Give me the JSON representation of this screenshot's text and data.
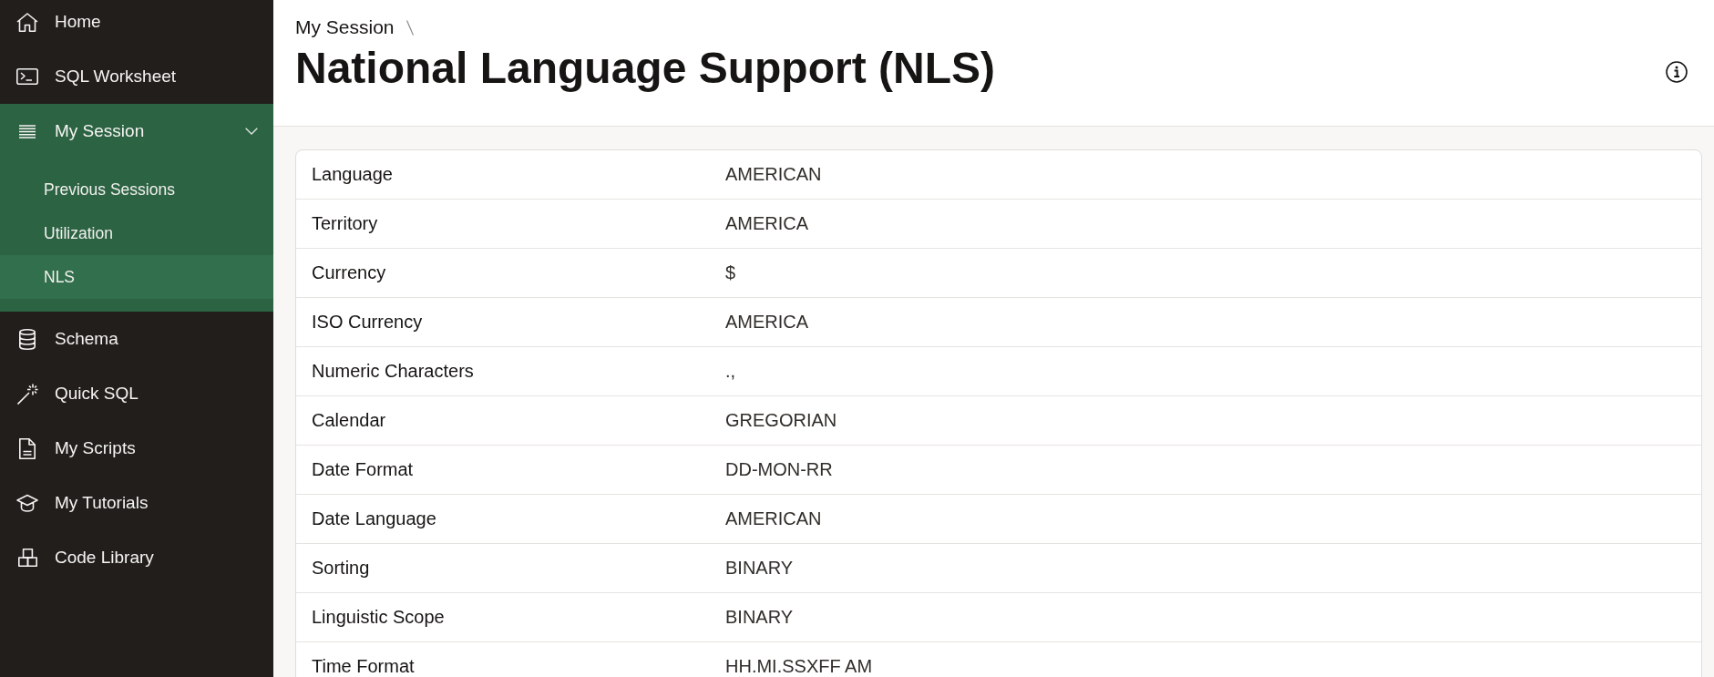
{
  "sidebar": {
    "items": [
      {
        "label": "Home",
        "selected": false
      },
      {
        "label": "SQL Worksheet",
        "selected": false
      },
      {
        "label": "My Session",
        "selected": true,
        "expanded": true,
        "children": [
          {
            "label": "Previous Sessions",
            "selected": false
          },
          {
            "label": "Utilization",
            "selected": false
          },
          {
            "label": "NLS",
            "selected": true
          }
        ]
      },
      {
        "label": "Schema",
        "selected": false
      },
      {
        "label": "Quick SQL",
        "selected": false
      },
      {
        "label": "My Scripts",
        "selected": false
      },
      {
        "label": "My Tutorials",
        "selected": false
      },
      {
        "label": "Code Library",
        "selected": false
      }
    ]
  },
  "header": {
    "breadcrumb": [
      {
        "label": "My Session"
      }
    ],
    "title": "National Language Support (NLS)"
  },
  "table": {
    "rows": [
      {
        "name": "Language",
        "value": "AMERICAN"
      },
      {
        "name": "Territory",
        "value": "AMERICA"
      },
      {
        "name": "Currency",
        "value": "$"
      },
      {
        "name": "ISO Currency",
        "value": "AMERICA"
      },
      {
        "name": "Numeric Characters",
        "value": ".,"
      },
      {
        "name": "Calendar",
        "value": "GREGORIAN"
      },
      {
        "name": "Date Format",
        "value": "DD-MON-RR"
      },
      {
        "name": "Date Language",
        "value": "AMERICAN"
      },
      {
        "name": "Sorting",
        "value": "BINARY"
      },
      {
        "name": "Linguistic Scope",
        "value": "BINARY"
      },
      {
        "name": "Time Format",
        "value": "HH.MI.SSXFF AM"
      }
    ]
  }
}
